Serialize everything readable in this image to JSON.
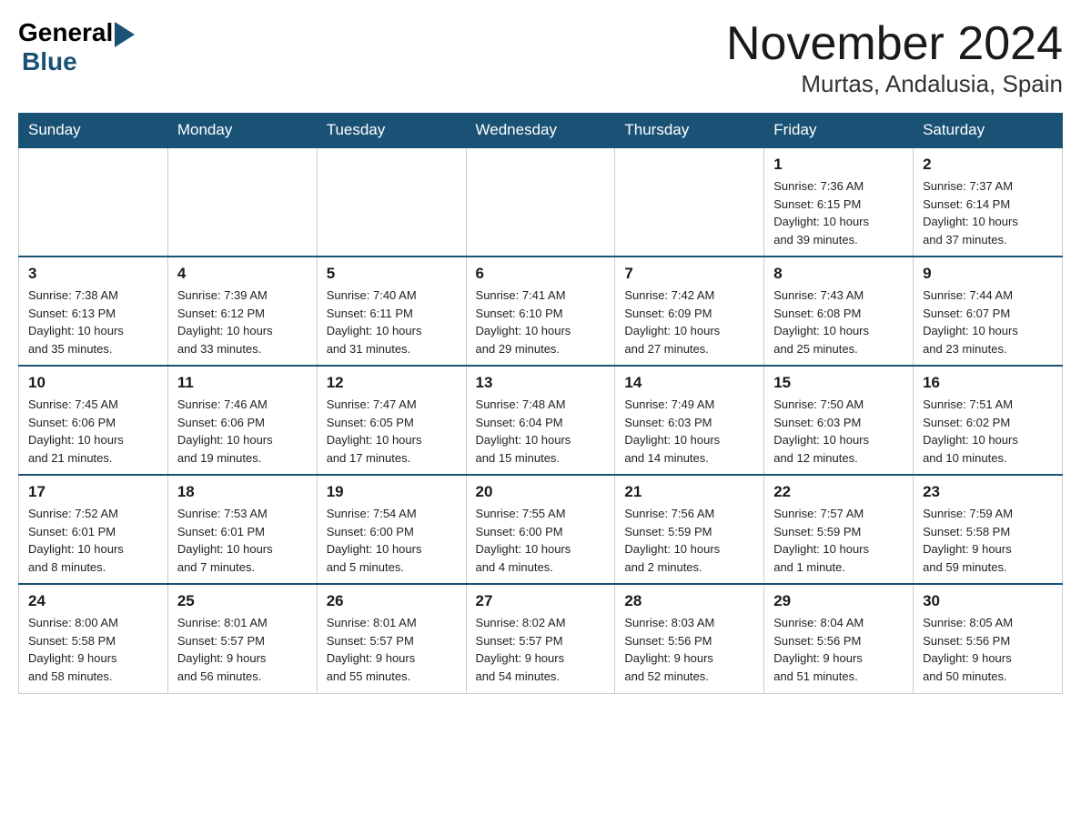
{
  "header": {
    "logo_general": "General",
    "logo_blue": "Blue",
    "month_title": "November 2024",
    "location": "Murtas, Andalusia, Spain"
  },
  "days_of_week": [
    "Sunday",
    "Monday",
    "Tuesday",
    "Wednesday",
    "Thursday",
    "Friday",
    "Saturday"
  ],
  "weeks": [
    [
      {
        "day": "",
        "info": ""
      },
      {
        "day": "",
        "info": ""
      },
      {
        "day": "",
        "info": ""
      },
      {
        "day": "",
        "info": ""
      },
      {
        "day": "",
        "info": ""
      },
      {
        "day": "1",
        "info": "Sunrise: 7:36 AM\nSunset: 6:15 PM\nDaylight: 10 hours\nand 39 minutes."
      },
      {
        "day": "2",
        "info": "Sunrise: 7:37 AM\nSunset: 6:14 PM\nDaylight: 10 hours\nand 37 minutes."
      }
    ],
    [
      {
        "day": "3",
        "info": "Sunrise: 7:38 AM\nSunset: 6:13 PM\nDaylight: 10 hours\nand 35 minutes."
      },
      {
        "day": "4",
        "info": "Sunrise: 7:39 AM\nSunset: 6:12 PM\nDaylight: 10 hours\nand 33 minutes."
      },
      {
        "day": "5",
        "info": "Sunrise: 7:40 AM\nSunset: 6:11 PM\nDaylight: 10 hours\nand 31 minutes."
      },
      {
        "day": "6",
        "info": "Sunrise: 7:41 AM\nSunset: 6:10 PM\nDaylight: 10 hours\nand 29 minutes."
      },
      {
        "day": "7",
        "info": "Sunrise: 7:42 AM\nSunset: 6:09 PM\nDaylight: 10 hours\nand 27 minutes."
      },
      {
        "day": "8",
        "info": "Sunrise: 7:43 AM\nSunset: 6:08 PM\nDaylight: 10 hours\nand 25 minutes."
      },
      {
        "day": "9",
        "info": "Sunrise: 7:44 AM\nSunset: 6:07 PM\nDaylight: 10 hours\nand 23 minutes."
      }
    ],
    [
      {
        "day": "10",
        "info": "Sunrise: 7:45 AM\nSunset: 6:06 PM\nDaylight: 10 hours\nand 21 minutes."
      },
      {
        "day": "11",
        "info": "Sunrise: 7:46 AM\nSunset: 6:06 PM\nDaylight: 10 hours\nand 19 minutes."
      },
      {
        "day": "12",
        "info": "Sunrise: 7:47 AM\nSunset: 6:05 PM\nDaylight: 10 hours\nand 17 minutes."
      },
      {
        "day": "13",
        "info": "Sunrise: 7:48 AM\nSunset: 6:04 PM\nDaylight: 10 hours\nand 15 minutes."
      },
      {
        "day": "14",
        "info": "Sunrise: 7:49 AM\nSunset: 6:03 PM\nDaylight: 10 hours\nand 14 minutes."
      },
      {
        "day": "15",
        "info": "Sunrise: 7:50 AM\nSunset: 6:03 PM\nDaylight: 10 hours\nand 12 minutes."
      },
      {
        "day": "16",
        "info": "Sunrise: 7:51 AM\nSunset: 6:02 PM\nDaylight: 10 hours\nand 10 minutes."
      }
    ],
    [
      {
        "day": "17",
        "info": "Sunrise: 7:52 AM\nSunset: 6:01 PM\nDaylight: 10 hours\nand 8 minutes."
      },
      {
        "day": "18",
        "info": "Sunrise: 7:53 AM\nSunset: 6:01 PM\nDaylight: 10 hours\nand 7 minutes."
      },
      {
        "day": "19",
        "info": "Sunrise: 7:54 AM\nSunset: 6:00 PM\nDaylight: 10 hours\nand 5 minutes."
      },
      {
        "day": "20",
        "info": "Sunrise: 7:55 AM\nSunset: 6:00 PM\nDaylight: 10 hours\nand 4 minutes."
      },
      {
        "day": "21",
        "info": "Sunrise: 7:56 AM\nSunset: 5:59 PM\nDaylight: 10 hours\nand 2 minutes."
      },
      {
        "day": "22",
        "info": "Sunrise: 7:57 AM\nSunset: 5:59 PM\nDaylight: 10 hours\nand 1 minute."
      },
      {
        "day": "23",
        "info": "Sunrise: 7:59 AM\nSunset: 5:58 PM\nDaylight: 9 hours\nand 59 minutes."
      }
    ],
    [
      {
        "day": "24",
        "info": "Sunrise: 8:00 AM\nSunset: 5:58 PM\nDaylight: 9 hours\nand 58 minutes."
      },
      {
        "day": "25",
        "info": "Sunrise: 8:01 AM\nSunset: 5:57 PM\nDaylight: 9 hours\nand 56 minutes."
      },
      {
        "day": "26",
        "info": "Sunrise: 8:01 AM\nSunset: 5:57 PM\nDaylight: 9 hours\nand 55 minutes."
      },
      {
        "day": "27",
        "info": "Sunrise: 8:02 AM\nSunset: 5:57 PM\nDaylight: 9 hours\nand 54 minutes."
      },
      {
        "day": "28",
        "info": "Sunrise: 8:03 AM\nSunset: 5:56 PM\nDaylight: 9 hours\nand 52 minutes."
      },
      {
        "day": "29",
        "info": "Sunrise: 8:04 AM\nSunset: 5:56 PM\nDaylight: 9 hours\nand 51 minutes."
      },
      {
        "day": "30",
        "info": "Sunrise: 8:05 AM\nSunset: 5:56 PM\nDaylight: 9 hours\nand 50 minutes."
      }
    ]
  ]
}
